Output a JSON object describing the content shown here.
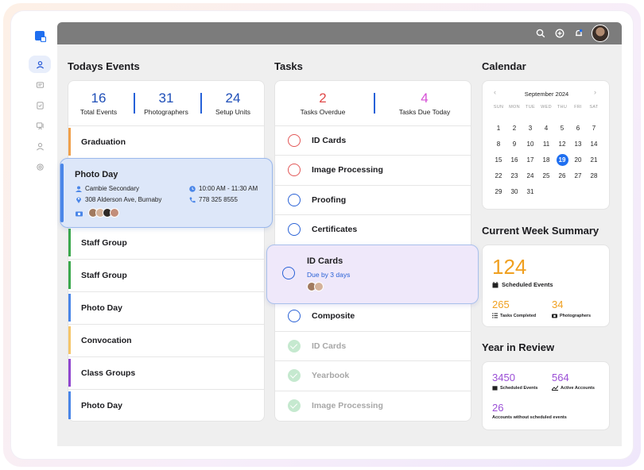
{
  "events": {
    "title": "Todays Events",
    "stats": [
      {
        "value": "16",
        "label": "Total Events"
      },
      {
        "value": "31",
        "label": "Photographers"
      },
      {
        "value": "24",
        "label": "Setup Units"
      }
    ],
    "rows": [
      {
        "name": "Graduation",
        "color": "#f0a04b"
      },
      {
        "name": "Staff Group",
        "color": "#3ba84d"
      },
      {
        "name": "Staff Group",
        "color": "#3ba84d"
      },
      {
        "name": "Photo Day",
        "color": "#4a86e8"
      },
      {
        "name": "Convocation",
        "color": "#f5c56a"
      },
      {
        "name": "Class Groups",
        "color": "#9046cf"
      },
      {
        "name": "Photo Day",
        "color": "#4a86e8"
      }
    ],
    "focused": {
      "name": "Photo Day",
      "school": "Cambie Secondary",
      "time": "10:00 AM - 11:30 AM",
      "address": "308 Alderson Ave, Burnaby",
      "phone": "778 325 8555"
    }
  },
  "tasks": {
    "title": "Tasks",
    "stats": [
      {
        "value": "2",
        "label": "Tasks Overdue",
        "color": "#e04848"
      },
      {
        "value": "4",
        "label": "Tasks Due Today",
        "color": "#d64fd6"
      }
    ],
    "rows": [
      {
        "name": "ID Cards",
        "state": "overdue"
      },
      {
        "name": "Image Processing",
        "state": "overdue"
      },
      {
        "name": "Proofing",
        "state": "open"
      },
      {
        "name": "Certificates",
        "state": "open"
      },
      {
        "name": "Composite",
        "state": "open"
      },
      {
        "name": "ID Cards",
        "state": "done"
      },
      {
        "name": "Yearbook",
        "state": "done"
      },
      {
        "name": "Image Processing",
        "state": "done"
      }
    ],
    "focused": {
      "name": "ID Cards",
      "due": "Due by 3 days"
    }
  },
  "calendar": {
    "title": "Calendar",
    "month": "September 2024",
    "weekdays": [
      "SUN",
      "MON",
      "TUE",
      "WED",
      "THU",
      "FRI",
      "SAT"
    ],
    "weeks": [
      [
        "1",
        "2",
        "3",
        "4",
        "5",
        "6",
        "7"
      ],
      [
        "8",
        "9",
        "10",
        "11",
        "12",
        "13",
        "14"
      ],
      [
        "15",
        "16",
        "17",
        "18",
        "19",
        "20",
        "21"
      ],
      [
        "22",
        "23",
        "24",
        "25",
        "26",
        "27",
        "28"
      ],
      [
        "29",
        "30",
        "31"
      ]
    ],
    "today": "19"
  },
  "week_summary": {
    "title": "Current Week Summary",
    "scheduled_value": "124",
    "scheduled_label": "Scheduled Events",
    "completed_value": "265",
    "completed_label": "Tasks Completed",
    "photographers_value": "34",
    "photographers_label": "Photographers"
  },
  "year_review": {
    "title": "Year in Review",
    "scheduled_value": "3450",
    "scheduled_label": "Scheduled Events",
    "active_value": "564",
    "active_label": "Active Accounts",
    "no_events_value": "26",
    "no_events_label": "Accounts without scheduled events"
  },
  "colors": {
    "accent": "#1f6ff0",
    "orange": "#f0a020",
    "purple": "#9b4fd6"
  }
}
